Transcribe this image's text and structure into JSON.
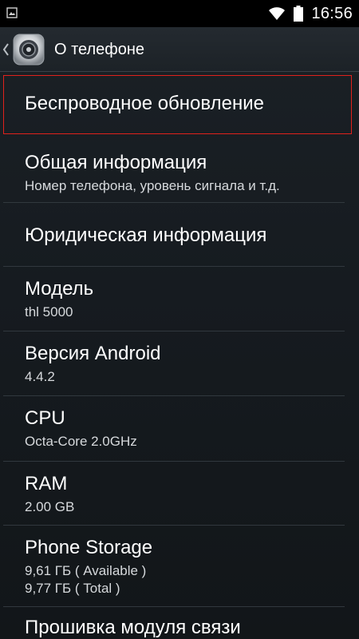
{
  "status_bar": {
    "time": "16:56",
    "left_icon": "image-notification-icon",
    "wifi_icon": "wifi-icon",
    "battery_icon": "battery-icon"
  },
  "action_bar": {
    "back_icon": "back-chevron-icon",
    "app_icon": "settings-app-icon",
    "title": "О телефоне"
  },
  "items": [
    {
      "title": "Беспроводное обновление",
      "summary": ""
    },
    {
      "title": "Общая информация",
      "summary": "Номер телефона, уровень сигнала и т.д."
    },
    {
      "title": "Юридическая информация",
      "summary": ""
    },
    {
      "title": "Модель",
      "summary": "thl 5000"
    },
    {
      "title": "Версия Android",
      "summary": "4.4.2"
    },
    {
      "title": "CPU",
      "summary": "Octa-Core 2.0GHz"
    },
    {
      "title": "RAM",
      "summary": "2.00 GB"
    },
    {
      "title": "Phone Storage",
      "summary": "9,61 ГБ  ( Available )",
      "summary2": "9,77 ГБ  ( Total )"
    },
    {
      "title": "Прошивка модуля связи",
      "summary": ""
    }
  ],
  "colors": {
    "accent_selection": "#e0211c",
    "background": "#181d22",
    "status_bar": "#000000"
  }
}
